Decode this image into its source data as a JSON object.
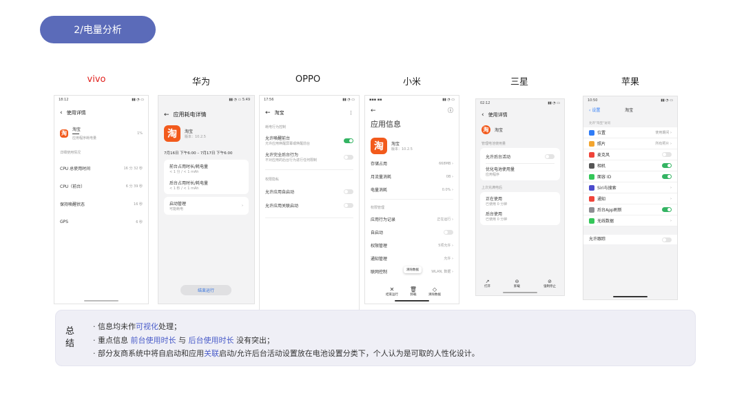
{
  "section_label": "2/电量分析",
  "brands": [
    "vivo",
    "华为",
    "OPPO",
    "小米",
    "三星",
    "苹果"
  ],
  "colors": {
    "accent": "#5b6bb9",
    "vivo_red": "#e0201c",
    "highlight": "#4a5cc9",
    "toggle_on": "#34b463"
  },
  "app_icon_char": "淘",
  "vivo": {
    "status_left": "18:12",
    "title": "使用详情",
    "app_name": "淘宝",
    "app_pct": "1%",
    "app_sub": "应用程序耗电量",
    "section": "详细使用情况",
    "rows": [
      {
        "label": "CPU 总使用时间",
        "value": "16 分 32 秒"
      },
      {
        "label": "CPU（前台）",
        "value": "6 分 39 秒"
      },
      {
        "label": "保持唤醒状态",
        "value": "16 秒"
      },
      {
        "label": "GPS",
        "value": "6 秒"
      }
    ]
  },
  "huawei": {
    "status_right": "5:49",
    "title": "应用耗电详情",
    "app_name": "淘宝",
    "version": "版本：10.2.5",
    "date_range": "7月16日 下午6:00 – 7月17日 下午6:00",
    "fg_label": "前台占用时长/耗电量",
    "fg_value": "< 1 分 / < 1 mAh",
    "bg_label": "后台占用时长/耗电量",
    "bg_value": "< 1 秒 / < 1 mAh",
    "launch_label": "启动管理",
    "launch_sub": "可能耗电",
    "end_button": "结束运行"
  },
  "oppo": {
    "status_left": "17:56",
    "title": "淘宝",
    "section1": "耗电行为控制",
    "wake_label": "允许唤醒前台",
    "wake_sub": "允许应用唤醒屏幕或唤醒前台",
    "bg_label": "允许完全后台行为",
    "bg_sub": "不对应用的后台行为进行任何限制",
    "section2": "权限隐私",
    "self_start": "允许应用自启动",
    "assoc_start": "允许应用关联启动"
  },
  "xiaomi": {
    "title": "应用信息",
    "app_name": "淘宝",
    "version": "版本：10.2.5",
    "rows1": [
      {
        "label": "存储占用",
        "value": "668MB"
      },
      {
        "label": "月流量消耗",
        "value": "0B"
      },
      {
        "label": "电量消耗",
        "value": "0.0%"
      }
    ],
    "section": "权限管理",
    "rows2": [
      {
        "label": "应用行为记录",
        "value": "正在运行"
      },
      {
        "label": "自启动",
        "value": ""
      },
      {
        "label": "权限管理",
        "value": "5项允许"
      },
      {
        "label": "通知管理",
        "value": "允许"
      },
      {
        "label": "联网控制",
        "value": "WLAN, 数据"
      }
    ],
    "tooltip": "清除数据",
    "bottom": [
      "结束运行",
      "卸载",
      "清除数据"
    ]
  },
  "samsung": {
    "status_left": "02:12",
    "title": "使用详情",
    "app_name": "淘宝",
    "section1": "管理电池使用量",
    "bg_label": "允许后台活动",
    "opt_label": "优化电池使用量",
    "opt_sub": "应用程序",
    "section2": "上次充满电后",
    "fg_label": "正在使用",
    "fg_value": "已使用 0 分钟",
    "bg_use_label": "后台使用",
    "bg_use_value": "已使用 0 分钟",
    "bottom": [
      "打开",
      "卸载",
      "强制停止"
    ]
  },
  "iphone": {
    "status_left": "10:50",
    "back": "设置",
    "title": "淘宝",
    "section": "允许\"淘宝\"访问",
    "rows": [
      {
        "label": "位置",
        "value": "使用期间",
        "icon": "location-icon",
        "color": "#2f7cf6",
        "control": "chevron"
      },
      {
        "label": "照片",
        "value": "所有照片",
        "icon": "photos-icon",
        "color": "#f3a52f",
        "control": "chevron"
      },
      {
        "label": "麦克风",
        "value": "",
        "icon": "microphone-icon",
        "color": "#f0443a",
        "control": "off"
      },
      {
        "label": "相机",
        "value": "",
        "icon": "camera-icon",
        "color": "#555555",
        "control": "on"
      },
      {
        "label": "面容 ID",
        "value": "",
        "icon": "face-id-icon",
        "color": "#34c759",
        "control": "on"
      },
      {
        "label": "Siri与搜索",
        "value": "",
        "icon": "siri-icon",
        "color": "#4b4bcc",
        "control": "chevron"
      },
      {
        "label": "通知",
        "value": "",
        "icon": "notification-icon",
        "color": "#f0443a",
        "control": "chevron"
      },
      {
        "label": "后台App刷新",
        "value": "",
        "icon": "refresh-icon",
        "color": "#8e8e93",
        "control": "on"
      },
      {
        "label": "无线数据",
        "value": "",
        "icon": "cellular-icon",
        "color": "#34c759",
        "control": "chevron"
      }
    ],
    "tracking_label": "允许跟踪"
  },
  "summary": {
    "title": "总结",
    "line1": {
      "pre": "· 信息均未作",
      "hl": "可视化",
      "post": "处理；"
    },
    "line2": {
      "pre": "· 重点信息 ",
      "hl1": "前台使用时长",
      "mid": " 与 ",
      "hl2": "后台使用时长",
      "post": " 没有突出；"
    },
    "line3": {
      "pre": "· 部分友商系统中将自启动和应用",
      "hl": "关联",
      "post": "启动/允许后台活动设置放在电池设置分类下，个人认为是可取的人性化设计。"
    }
  }
}
